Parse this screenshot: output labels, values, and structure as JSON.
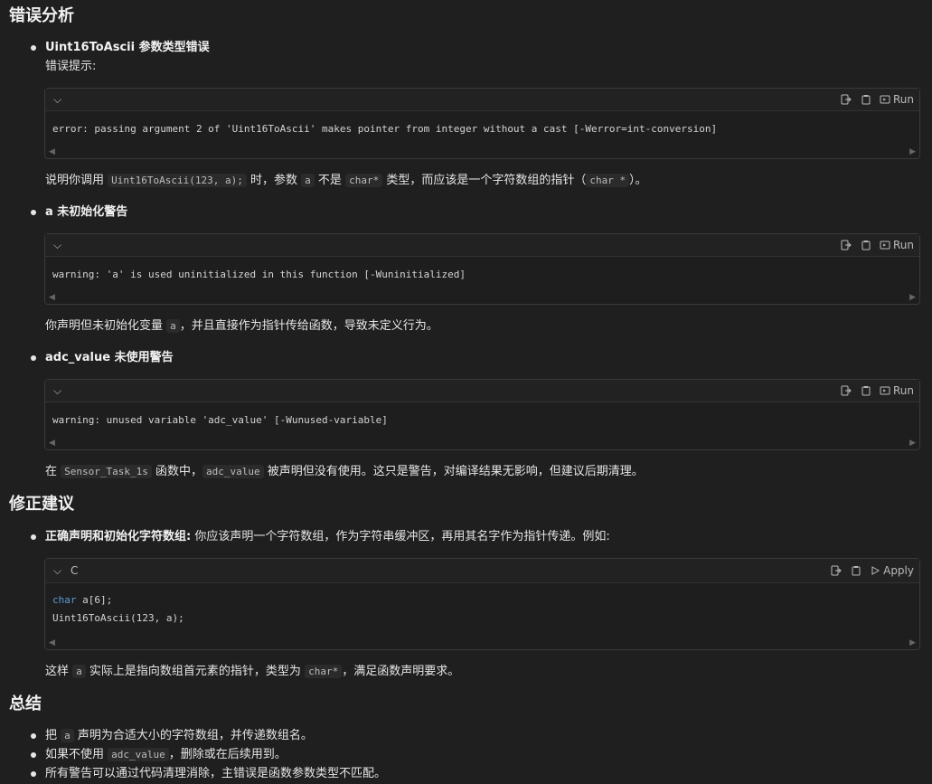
{
  "sections": {
    "analysis_title": "错误分析",
    "fix_title": "修正建议",
    "summary_title": "总结"
  },
  "analysis": {
    "item1": {
      "title": "Uint16ToAscii 参数类型错误",
      "hint_label": "错误提示:",
      "code": "error: passing argument 2 of 'Uint16ToAscii' makes pointer from integer without a cast [-Werror=int-conversion]",
      "desc_pre": "说明你调用",
      "desc_code1": "Uint16ToAscii(123, a);",
      "desc_mid1": "时，参数",
      "desc_code2": "a",
      "desc_mid2": "不是",
      "desc_code3": "char*",
      "desc_mid3": "类型，而应该是一个字符数组的指针（",
      "desc_code4": "char *",
      "desc_post": "）。"
    },
    "item2": {
      "title": "a 未初始化警告",
      "code": "warning: 'a' is used uninitialized in this function [-Wuninitialized]",
      "desc_pre": "你声明但未初始化变量",
      "desc_code1": "a",
      "desc_post": "，并且直接作为指针传给函数，导致未定义行为。"
    },
    "item3": {
      "title": "adc_value 未使用警告",
      "code": "warning: unused variable 'adc_value' [-Wunused-variable]",
      "desc_pre": "在",
      "desc_code1": "Sensor_Task_1s",
      "desc_mid1": "函数中，",
      "desc_code2": "adc_value",
      "desc_post": "被声明但没有使用。这只是警告，对编译结果无影响，但建议后期清理。"
    }
  },
  "fix": {
    "title": "正确声明和初始化字符数组:",
    "text": "你应该声明一个字符数组，作为字符串缓冲区，再用其名字作为指针传递。例如:",
    "lang": "C",
    "code_line1_kw": "char",
    "code_line1_rest": " a[6];",
    "code_line2": "Uint16ToAscii(123, a);",
    "desc_pre": "这样",
    "desc_code1": "a",
    "desc_mid1": "实际上是指向数组首元素的指针，类型为",
    "desc_code2": "char*",
    "desc_post": "，满足函数声明要求。"
  },
  "summary": {
    "item1_pre": "把",
    "item1_code": "a",
    "item1_post": "声明为合适大小的字符数组，并传递数组名。",
    "item2_pre": "如果不使用",
    "item2_code": "adc_value",
    "item2_post": "，删除或在后续用到。",
    "item3": "所有警告可以通过代码清理消除，主错误是函数参数类型不匹配。"
  },
  "toolbar": {
    "run_label": "Run",
    "apply_label": "Apply"
  },
  "icons": [
    "chevron-down-icon",
    "insert-icon",
    "copy-icon",
    "run-icon",
    "apply-icon"
  ]
}
